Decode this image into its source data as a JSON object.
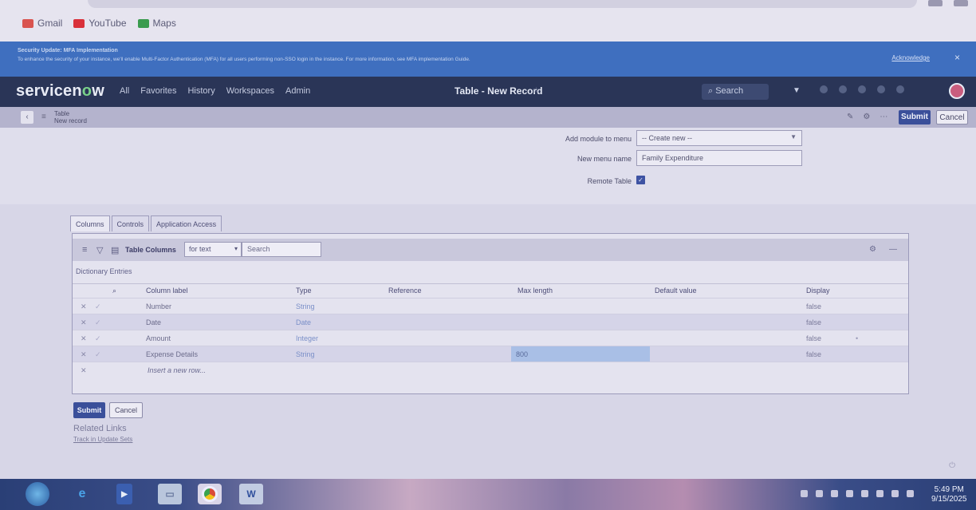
{
  "browser": {
    "bookmarks": [
      {
        "label": "Gmail",
        "color": "#d9534f"
      },
      {
        "label": "YouTube",
        "color": "#d9303a"
      },
      {
        "label": "Maps",
        "color": "#3a9b4e"
      }
    ]
  },
  "banner": {
    "title": "Security Update: MFA Implementation",
    "text": "To enhance the security of your instance, we'll enable Multi-Factor Authentication (MFA) for all users performing non-SSO login in the instance. For more information, see MFA implementation Guide.",
    "ack": "Acknowledge",
    "close": "×"
  },
  "nav": {
    "logo_a": "servicen",
    "logo_b": "o",
    "logo_c": "w",
    "items": [
      "All",
      "Favorites",
      "History",
      "Workspaces",
      "Admin"
    ],
    "title": "Table - New Record",
    "star": "☆",
    "search_placeholder": "Search"
  },
  "record": {
    "line1": "Table",
    "line2": "New record",
    "submit": "Submit",
    "cancel": "Cancel"
  },
  "form": {
    "module_label": "Add module to menu",
    "module_value": "-- Create new --",
    "menu_label": "New menu name",
    "menu_value": "Family Expenditure",
    "remote_label": "Remote Table",
    "remote_checked": "✓"
  },
  "tabs": [
    "Columns",
    "Controls",
    "Application Access"
  ],
  "list": {
    "title": "Table Columns",
    "filter_value": "for text",
    "search_placeholder": "Search",
    "section": "Dictionary Entries",
    "headers": [
      "Column label",
      "Type",
      "Reference",
      "Max length",
      "Default value",
      "Display"
    ],
    "rows": [
      {
        "label": "Number",
        "type": "String",
        "max": "",
        "display": "false"
      },
      {
        "label": "Date",
        "type": "Date",
        "max": "",
        "display": "false"
      },
      {
        "label": "Amount",
        "type": "Integer",
        "max": "",
        "display": "false"
      },
      {
        "label": "Expense Details",
        "type": "String",
        "max": "800",
        "display": "false"
      }
    ],
    "insert": "Insert a new row..."
  },
  "bottom": {
    "submit": "Submit",
    "cancel": "Cancel",
    "related": "Related Links",
    "related_link": "Track in Update Sets"
  },
  "taskbar": {
    "time": "5:49 PM",
    "date": "9/15/2025"
  }
}
